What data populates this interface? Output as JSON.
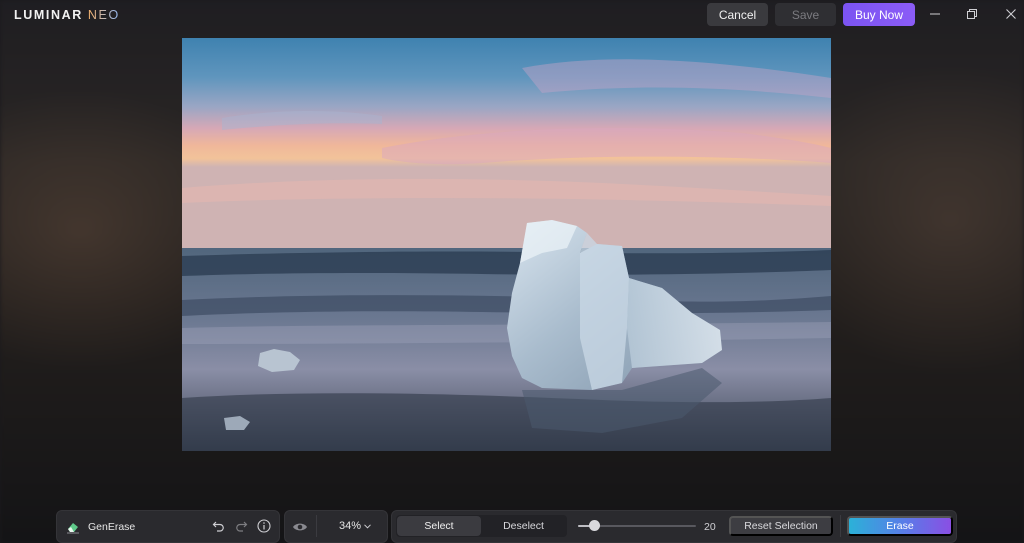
{
  "app": {
    "logo_main": "LUMINAR",
    "logo_accent": "NEO"
  },
  "titlebar": {
    "cancel_label": "Cancel",
    "save_label": "Save",
    "buy_label": "Buy Now"
  },
  "toolbar": {
    "tool_name": "GenErase",
    "zoom_label": "34%",
    "select_label": "Select",
    "deselect_label": "Deselect",
    "brush_size_value": "20",
    "brush_size_fraction": 0.14,
    "reset_selection_label": "Reset Selection",
    "erase_label": "Erase"
  },
  "colors": {
    "accent_purple": "#7b54f2",
    "erase_gradient_start": "#2bb1d8",
    "erase_gradient_end": "#8a4fe3",
    "panel_bg": "#2a2a2e"
  },
  "icons": {
    "tool": "eraser-icon",
    "undo": "undo-icon",
    "redo": "redo-icon",
    "info": "info-icon",
    "preview": "eye-icon",
    "zoom_menu": "chevron-down-icon"
  }
}
